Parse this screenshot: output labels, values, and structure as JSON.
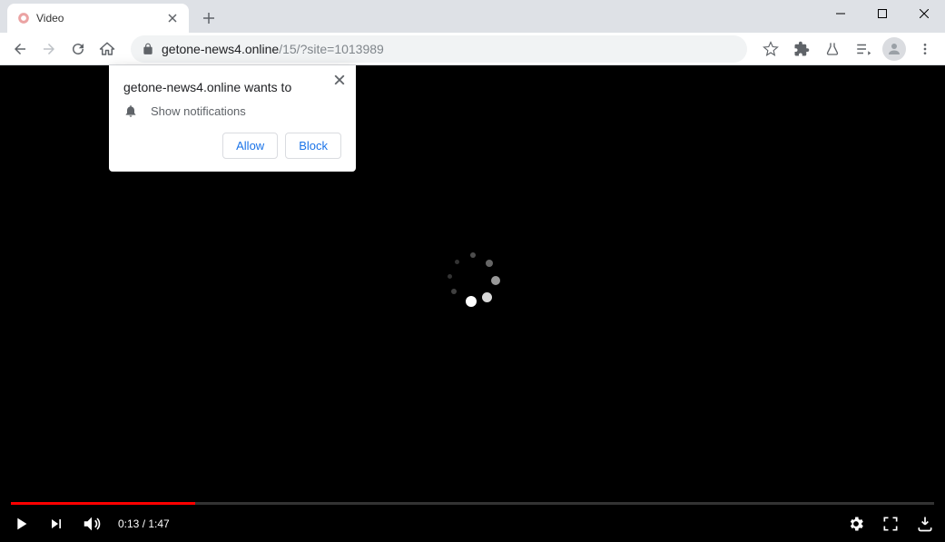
{
  "window": {
    "tab_title": "Video"
  },
  "address_bar": {
    "host": "getone-news4.online",
    "path": "/15/?site=1013989"
  },
  "permission_popup": {
    "origin_text": "getone-news4.online wants to",
    "permission_label": "Show notifications",
    "allow_label": "Allow",
    "block_label": "Block"
  },
  "player": {
    "current_time": "0:13",
    "duration": "1:47",
    "progress_percent": 20
  }
}
